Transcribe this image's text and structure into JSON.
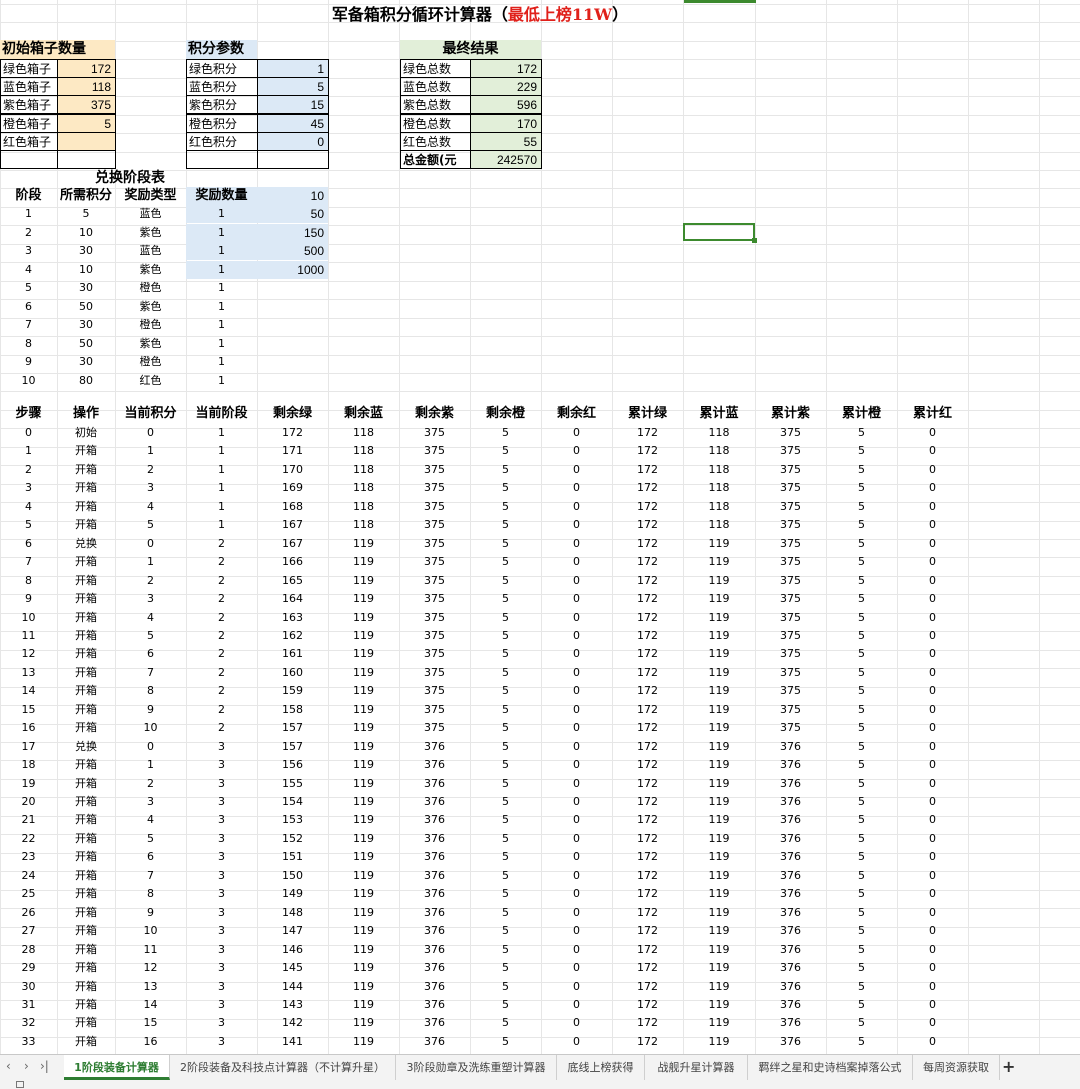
{
  "title": {
    "main": "军备箱积分循环计算器（",
    "highlight": "最低上榜11W",
    "end": "）"
  },
  "init_boxes": {
    "header": "初始箱子数量",
    "rows": [
      {
        "label": "绿色箱子",
        "value": "172"
      },
      {
        "label": "蓝色箱子",
        "value": "118"
      },
      {
        "label": "紫色箱子",
        "value": "375"
      },
      {
        "label": "橙色箱子",
        "value": "5"
      },
      {
        "label": "红色箱子",
        "value": ""
      }
    ]
  },
  "points_params": {
    "header": "积分参数",
    "rows": [
      {
        "label": "绿色积分",
        "value": "1"
      },
      {
        "label": "蓝色积分",
        "value": "5"
      },
      {
        "label": "紫色积分",
        "value": "15"
      },
      {
        "label": "橙色积分",
        "value": "45"
      },
      {
        "label": "红色积分",
        "value": "0"
      }
    ]
  },
  "final_result": {
    "header": "最终结果",
    "rows": [
      {
        "label": "绿色总数",
        "value": "172"
      },
      {
        "label": "蓝色总数",
        "value": "229"
      },
      {
        "label": "紫色总数",
        "value": "596"
      },
      {
        "label": "橙色总数",
        "value": "170"
      },
      {
        "label": "红色总数",
        "value": "55"
      },
      {
        "label": "总金额(元",
        "value": "242570"
      }
    ]
  },
  "exchange_table": {
    "title": "兑换阶段表",
    "headers": [
      "阶段",
      "所需积分",
      "奖励类型",
      "奖励数量"
    ],
    "rows": [
      [
        "1",
        "5",
        "蓝色",
        "1"
      ],
      [
        "2",
        "10",
        "紫色",
        "1"
      ],
      [
        "3",
        "30",
        "蓝色",
        "1"
      ],
      [
        "4",
        "10",
        "紫色",
        "1"
      ],
      [
        "5",
        "30",
        "橙色",
        "1"
      ],
      [
        "6",
        "50",
        "紫色",
        "1"
      ],
      [
        "7",
        "30",
        "橙色",
        "1"
      ],
      [
        "8",
        "50",
        "紫色",
        "1"
      ],
      [
        "9",
        "30",
        "橙色",
        "1"
      ],
      [
        "10",
        "80",
        "红色",
        "1"
      ]
    ],
    "side_values": [
      "10",
      "50",
      "150",
      "500",
      "1000"
    ]
  },
  "steps_table": {
    "headers": [
      "步骤",
      "操作",
      "当前积分",
      "当前阶段",
      "剩余绿",
      "剩余蓝",
      "剩余紫",
      "剩余橙",
      "剩余红",
      "累计绿",
      "累计蓝",
      "累计紫",
      "累计橙",
      "累计红"
    ],
    "rows": [
      [
        "0",
        "初始",
        "0",
        "1",
        "172",
        "118",
        "375",
        "5",
        "0",
        "172",
        "118",
        "375",
        "5",
        "0"
      ],
      [
        "1",
        "开箱",
        "1",
        "1",
        "171",
        "118",
        "375",
        "5",
        "0",
        "172",
        "118",
        "375",
        "5",
        "0"
      ],
      [
        "2",
        "开箱",
        "2",
        "1",
        "170",
        "118",
        "375",
        "5",
        "0",
        "172",
        "118",
        "375",
        "5",
        "0"
      ],
      [
        "3",
        "开箱",
        "3",
        "1",
        "169",
        "118",
        "375",
        "5",
        "0",
        "172",
        "118",
        "375",
        "5",
        "0"
      ],
      [
        "4",
        "开箱",
        "4",
        "1",
        "168",
        "118",
        "375",
        "5",
        "0",
        "172",
        "118",
        "375",
        "5",
        "0"
      ],
      [
        "5",
        "开箱",
        "5",
        "1",
        "167",
        "118",
        "375",
        "5",
        "0",
        "172",
        "118",
        "375",
        "5",
        "0"
      ],
      [
        "6",
        "兑换",
        "0",
        "2",
        "167",
        "119",
        "375",
        "5",
        "0",
        "172",
        "119",
        "375",
        "5",
        "0"
      ],
      [
        "7",
        "开箱",
        "1",
        "2",
        "166",
        "119",
        "375",
        "5",
        "0",
        "172",
        "119",
        "375",
        "5",
        "0"
      ],
      [
        "8",
        "开箱",
        "2",
        "2",
        "165",
        "119",
        "375",
        "5",
        "0",
        "172",
        "119",
        "375",
        "5",
        "0"
      ],
      [
        "9",
        "开箱",
        "3",
        "2",
        "164",
        "119",
        "375",
        "5",
        "0",
        "172",
        "119",
        "375",
        "5",
        "0"
      ],
      [
        "10",
        "开箱",
        "4",
        "2",
        "163",
        "119",
        "375",
        "5",
        "0",
        "172",
        "119",
        "375",
        "5",
        "0"
      ],
      [
        "11",
        "开箱",
        "5",
        "2",
        "162",
        "119",
        "375",
        "5",
        "0",
        "172",
        "119",
        "375",
        "5",
        "0"
      ],
      [
        "12",
        "开箱",
        "6",
        "2",
        "161",
        "119",
        "375",
        "5",
        "0",
        "172",
        "119",
        "375",
        "5",
        "0"
      ],
      [
        "13",
        "开箱",
        "7",
        "2",
        "160",
        "119",
        "375",
        "5",
        "0",
        "172",
        "119",
        "375",
        "5",
        "0"
      ],
      [
        "14",
        "开箱",
        "8",
        "2",
        "159",
        "119",
        "375",
        "5",
        "0",
        "172",
        "119",
        "375",
        "5",
        "0"
      ],
      [
        "15",
        "开箱",
        "9",
        "2",
        "158",
        "119",
        "375",
        "5",
        "0",
        "172",
        "119",
        "375",
        "5",
        "0"
      ],
      [
        "16",
        "开箱",
        "10",
        "2",
        "157",
        "119",
        "375",
        "5",
        "0",
        "172",
        "119",
        "375",
        "5",
        "0"
      ],
      [
        "17",
        "兑换",
        "0",
        "3",
        "157",
        "119",
        "376",
        "5",
        "0",
        "172",
        "119",
        "376",
        "5",
        "0"
      ],
      [
        "18",
        "开箱",
        "1",
        "3",
        "156",
        "119",
        "376",
        "5",
        "0",
        "172",
        "119",
        "376",
        "5",
        "0"
      ],
      [
        "19",
        "开箱",
        "2",
        "3",
        "155",
        "119",
        "376",
        "5",
        "0",
        "172",
        "119",
        "376",
        "5",
        "0"
      ],
      [
        "20",
        "开箱",
        "3",
        "3",
        "154",
        "119",
        "376",
        "5",
        "0",
        "172",
        "119",
        "376",
        "5",
        "0"
      ],
      [
        "21",
        "开箱",
        "4",
        "3",
        "153",
        "119",
        "376",
        "5",
        "0",
        "172",
        "119",
        "376",
        "5",
        "0"
      ],
      [
        "22",
        "开箱",
        "5",
        "3",
        "152",
        "119",
        "376",
        "5",
        "0",
        "172",
        "119",
        "376",
        "5",
        "0"
      ],
      [
        "23",
        "开箱",
        "6",
        "3",
        "151",
        "119",
        "376",
        "5",
        "0",
        "172",
        "119",
        "376",
        "5",
        "0"
      ],
      [
        "24",
        "开箱",
        "7",
        "3",
        "150",
        "119",
        "376",
        "5",
        "0",
        "172",
        "119",
        "376",
        "5",
        "0"
      ],
      [
        "25",
        "开箱",
        "8",
        "3",
        "149",
        "119",
        "376",
        "5",
        "0",
        "172",
        "119",
        "376",
        "5",
        "0"
      ],
      [
        "26",
        "开箱",
        "9",
        "3",
        "148",
        "119",
        "376",
        "5",
        "0",
        "172",
        "119",
        "376",
        "5",
        "0"
      ],
      [
        "27",
        "开箱",
        "10",
        "3",
        "147",
        "119",
        "376",
        "5",
        "0",
        "172",
        "119",
        "376",
        "5",
        "0"
      ],
      [
        "28",
        "开箱",
        "11",
        "3",
        "146",
        "119",
        "376",
        "5",
        "0",
        "172",
        "119",
        "376",
        "5",
        "0"
      ],
      [
        "29",
        "开箱",
        "12",
        "3",
        "145",
        "119",
        "376",
        "5",
        "0",
        "172",
        "119",
        "376",
        "5",
        "0"
      ],
      [
        "30",
        "开箱",
        "13",
        "3",
        "144",
        "119",
        "376",
        "5",
        "0",
        "172",
        "119",
        "376",
        "5",
        "0"
      ],
      [
        "31",
        "开箱",
        "14",
        "3",
        "143",
        "119",
        "376",
        "5",
        "0",
        "172",
        "119",
        "376",
        "5",
        "0"
      ],
      [
        "32",
        "开箱",
        "15",
        "3",
        "142",
        "119",
        "376",
        "5",
        "0",
        "172",
        "119",
        "376",
        "5",
        "0"
      ],
      [
        "33",
        "开箱",
        "16",
        "3",
        "141",
        "119",
        "376",
        "5",
        "0",
        "172",
        "119",
        "376",
        "5",
        "0"
      ]
    ]
  },
  "sheet_tabs": [
    {
      "label": "1阶段装备计算器",
      "active": true
    },
    {
      "label": "2阶段装备及科技点计算器（不计算升星）",
      "active": false
    },
    {
      "label": "3阶段勋章及洗练重塑计算器",
      "active": false
    },
    {
      "label": "底线上榜获得",
      "active": false
    },
    {
      "label": "战舰升星计算器",
      "active": false
    },
    {
      "label": "羁绊之星和史诗档案掉落公式",
      "active": false
    },
    {
      "label": "每周资源获取",
      "active": false
    }
  ],
  "nav": {
    "first": "‹",
    "prev": "›",
    "next": "›|",
    "add": "+"
  },
  "colors": {
    "orange_fill": "#fde9c4",
    "blue_fill": "#dce9f6",
    "green_fill": "#e2efd9",
    "red_text": "#e0201a",
    "active_tab": "#2e7d32",
    "grid": "#e6e6e6"
  }
}
